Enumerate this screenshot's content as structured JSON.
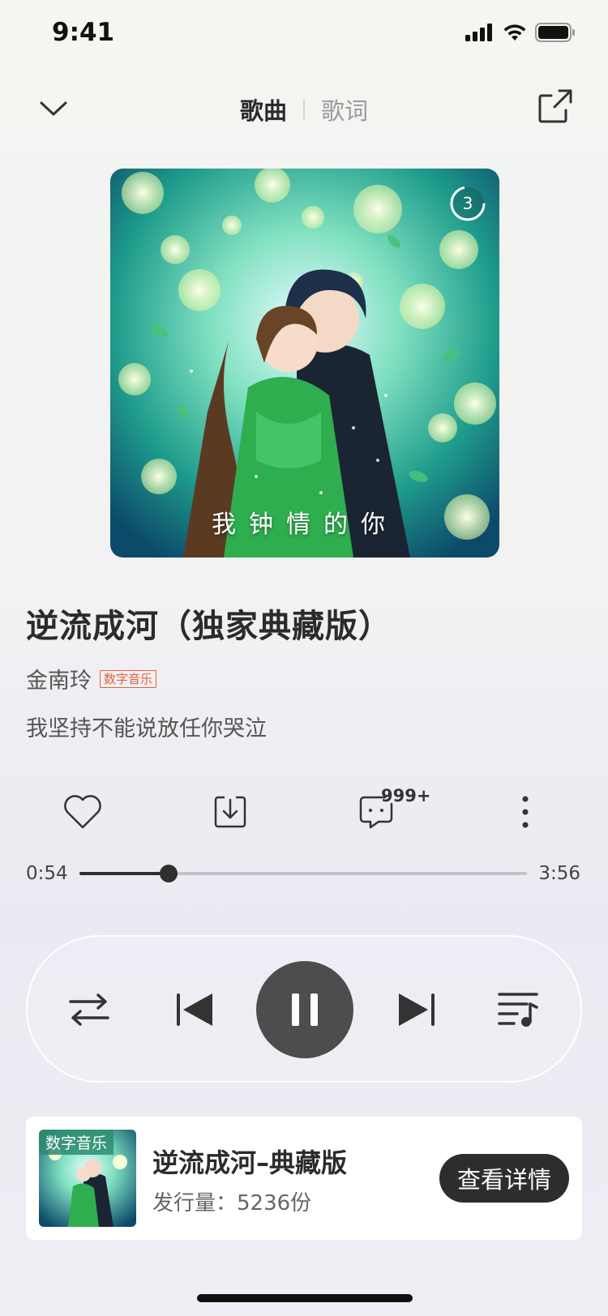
{
  "status_bar": {
    "time": "9:41"
  },
  "nav": {
    "tabs": [
      {
        "label": "歌曲",
        "active": true
      },
      {
        "label": "歌词",
        "active": false
      }
    ]
  },
  "cover": {
    "badge_number": "3",
    "art_text": "我钟情的你"
  },
  "song": {
    "title": "逆流成河（独家典藏版）",
    "artist": "金南玲",
    "tag": "数字音乐",
    "lyric": "我坚持不能说放任你哭泣"
  },
  "actions": {
    "comment_count": "999+"
  },
  "progress": {
    "current": "0:54",
    "total": "3:56",
    "fraction": 0.2
  },
  "card": {
    "tag": "数字音乐",
    "title": "逆流成河–典藏版",
    "subtitle": "发行量：5236份",
    "button": "查看详情"
  },
  "colors": {
    "accent_tag": "#e0633a",
    "dark": "#2d2d2d",
    "play_button": "#4d4d4d"
  }
}
